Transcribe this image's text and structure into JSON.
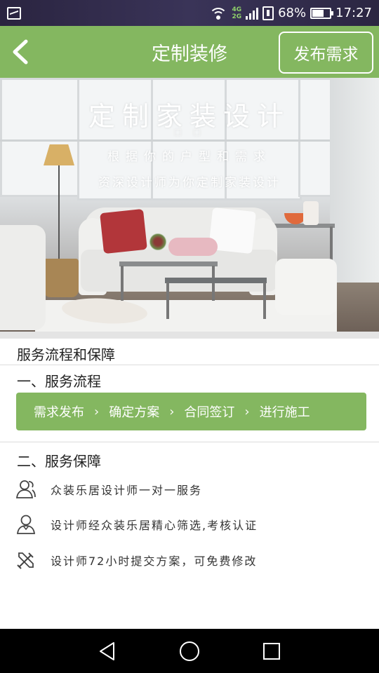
{
  "status_bar": {
    "net_top": "4G",
    "net_bottom": "2G",
    "battery": "68%",
    "battery_level": 0.68,
    "time": "17:27"
  },
  "header": {
    "title": "定制装修",
    "publish_label": "发布需求",
    "background": "#84b760"
  },
  "banner": {
    "title": "定制家装设计",
    "dots": "□ □",
    "line1": "根据你的户型和需求",
    "line2": "资深设计师为你定制家装设计"
  },
  "main": {
    "section_title": "服务流程和保障",
    "process": {
      "title": "一、服务流程",
      "steps": [
        "需求发布",
        "确定方案",
        "合同签订",
        "进行施工"
      ],
      "arrow": "›"
    },
    "guarantee": {
      "title": "二、服务保障",
      "items": [
        {
          "icon": "people-icon",
          "text": "众装乐居设计师一对一服务"
        },
        {
          "icon": "person-icon",
          "text": "设计师经众装乐居精心筛选,考核认证"
        },
        {
          "icon": "tools-icon",
          "text": "设计师72小时提交方案，可免费修改"
        }
      ]
    }
  },
  "nav": {
    "icons": [
      "back-triangle-icon",
      "home-circle-icon",
      "recents-square-icon"
    ]
  }
}
